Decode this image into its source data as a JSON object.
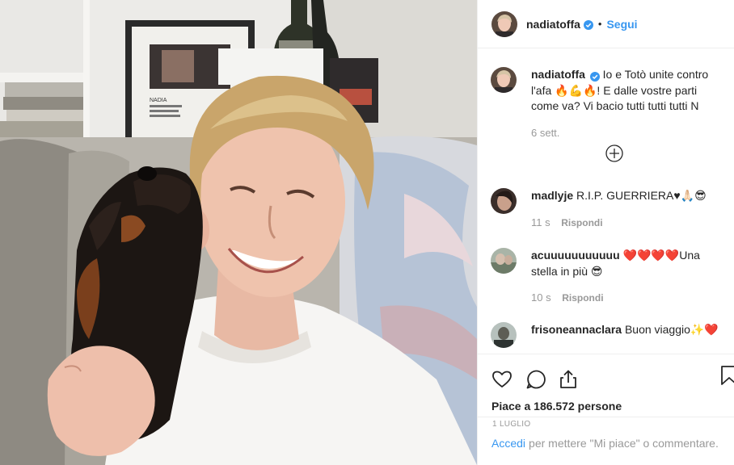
{
  "post": {
    "username": "nadiatoffa",
    "follow_label": "Segui",
    "dot": "•"
  },
  "caption": {
    "username": "nadiatoffa",
    "text": "Io e Totò unite contro l'afa 🔥💪🔥! E dalle vostre parti come va? Vi bacio tutti tutti tutti N",
    "time": "6 sett."
  },
  "comments": [
    {
      "username": "madlyje",
      "text": "R.I.P. GUERRIERA♥🙏🏻😎",
      "time": "11 s",
      "reply_label": "Rispondi"
    },
    {
      "username": "acuuuuuuuuuuu",
      "text": "❤️❤️❤️❤️Una stella in più 😎",
      "time": "10 s",
      "reply_label": "Rispondi"
    },
    {
      "username": "frisoneannaclara",
      "text": "Buon viaggio✨❤️",
      "time": "",
      "reply_label": ""
    }
  ],
  "likes_text": "Piace a 186.572 persone",
  "date_text": "1 luglio",
  "add_comment": {
    "link": "Accedi",
    "rest": "per mettere \"Mi piace\" o commentare."
  },
  "photo_text": {
    "poster_line": "NADIA"
  },
  "colors": {
    "accent": "#3897f0",
    "verified": "#3897f0",
    "text": "#262626",
    "muted": "#999999"
  },
  "icons": [
    "heart-icon",
    "comment-icon",
    "share-icon",
    "bookmark-icon",
    "plus-circle-icon",
    "verified-badge-icon"
  ]
}
